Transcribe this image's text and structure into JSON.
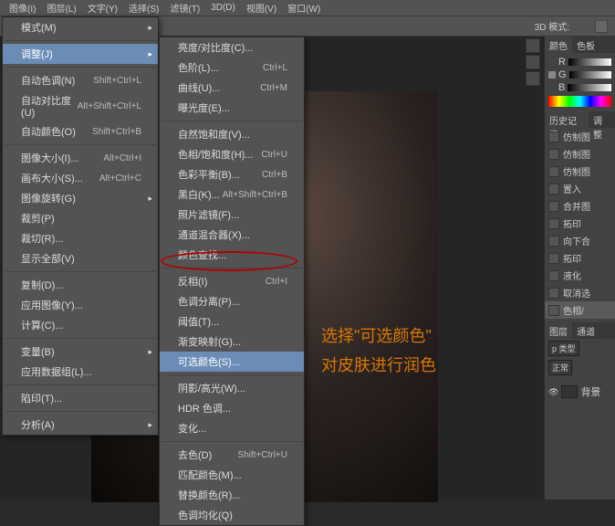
{
  "menubar": [
    "图像(I)",
    "图层(L)",
    "文字(Y)",
    "选择(S)",
    "滤镜(T)",
    "3D(D)",
    "视图(V)",
    "窗口(W)"
  ],
  "toolbar": {
    "mode_label": "3D 模式:"
  },
  "submenu1": {
    "groups": [
      [
        {
          "label": "模式(M)",
          "arrow": true
        }
      ],
      [
        {
          "label": "调整(J)",
          "arrow": true,
          "hl": true
        }
      ],
      [
        {
          "label": "自动色调(N)",
          "shortcut": "Shift+Ctrl+L"
        },
        {
          "label": "自动对比度(U)",
          "shortcut": "Alt+Shift+Ctrl+L"
        },
        {
          "label": "自动颜色(O)",
          "shortcut": "Shift+Ctrl+B"
        }
      ],
      [
        {
          "label": "图像大小(I)...",
          "shortcut": "Alt+Ctrl+I"
        },
        {
          "label": "画布大小(S)...",
          "shortcut": "Alt+Ctrl+C"
        },
        {
          "label": "图像旋转(G)",
          "arrow": true
        },
        {
          "label": "裁剪(P)"
        },
        {
          "label": "裁切(R)..."
        },
        {
          "label": "显示全部(V)"
        }
      ],
      [
        {
          "label": "复制(D)..."
        },
        {
          "label": "应用图像(Y)..."
        },
        {
          "label": "计算(C)..."
        }
      ],
      [
        {
          "label": "变量(B)",
          "arrow": true
        },
        {
          "label": "应用数据组(L)..."
        }
      ],
      [
        {
          "label": "陷印(T)..."
        }
      ],
      [
        {
          "label": "分析(A)",
          "arrow": true
        }
      ]
    ]
  },
  "submenu2": {
    "groups": [
      [
        {
          "label": "亮度/对比度(C)..."
        },
        {
          "label": "色阶(L)...",
          "shortcut": "Ctrl+L"
        },
        {
          "label": "曲线(U)...",
          "shortcut": "Ctrl+M"
        },
        {
          "label": "曝光度(E)..."
        }
      ],
      [
        {
          "label": "自然饱和度(V)..."
        },
        {
          "label": "色相/饱和度(H)...",
          "shortcut": "Ctrl+U"
        },
        {
          "label": "色彩平衡(B)...",
          "shortcut": "Ctrl+B"
        },
        {
          "label": "黑白(K)...",
          "shortcut": "Alt+Shift+Ctrl+B"
        },
        {
          "label": "照片滤镜(F)..."
        },
        {
          "label": "通道混合器(X)..."
        },
        {
          "label": "颜色查找..."
        }
      ],
      [
        {
          "label": "反相(I)",
          "shortcut": "Ctrl+I"
        },
        {
          "label": "色调分离(P)..."
        },
        {
          "label": "阈值(T)..."
        },
        {
          "label": "渐变映射(G)..."
        },
        {
          "label": "可选颜色(S)...",
          "hl": true
        }
      ],
      [
        {
          "label": "阴影/高光(W)..."
        },
        {
          "label": "HDR 色调..."
        },
        {
          "label": "变化..."
        }
      ],
      [
        {
          "label": "去色(D)",
          "shortcut": "Shift+Ctrl+U"
        },
        {
          "label": "匹配颜色(M)..."
        },
        {
          "label": "替换颜色(R)..."
        },
        {
          "label": "色调均化(Q)"
        }
      ]
    ]
  },
  "annotation": {
    "line1": "选择\"可选颜色\"",
    "line2": "对皮肤进行润色"
  },
  "rightpanel": {
    "color_tabs": [
      "颜色",
      "色板"
    ],
    "rgb": [
      "R",
      "G",
      "B"
    ],
    "history_tab1": "历史记录",
    "history_tab2": "调整",
    "history": [
      "仿制图",
      "仿制图",
      "仿制图",
      "置入",
      "合并图",
      "拓印",
      "向下合",
      "拓印",
      "液化",
      "取消选",
      "色相/"
    ],
    "layers_tab1": "图层",
    "layers_tab2": "通道",
    "type_label": "p 类型",
    "blend_mode": "正常",
    "layer_name": "背景"
  }
}
